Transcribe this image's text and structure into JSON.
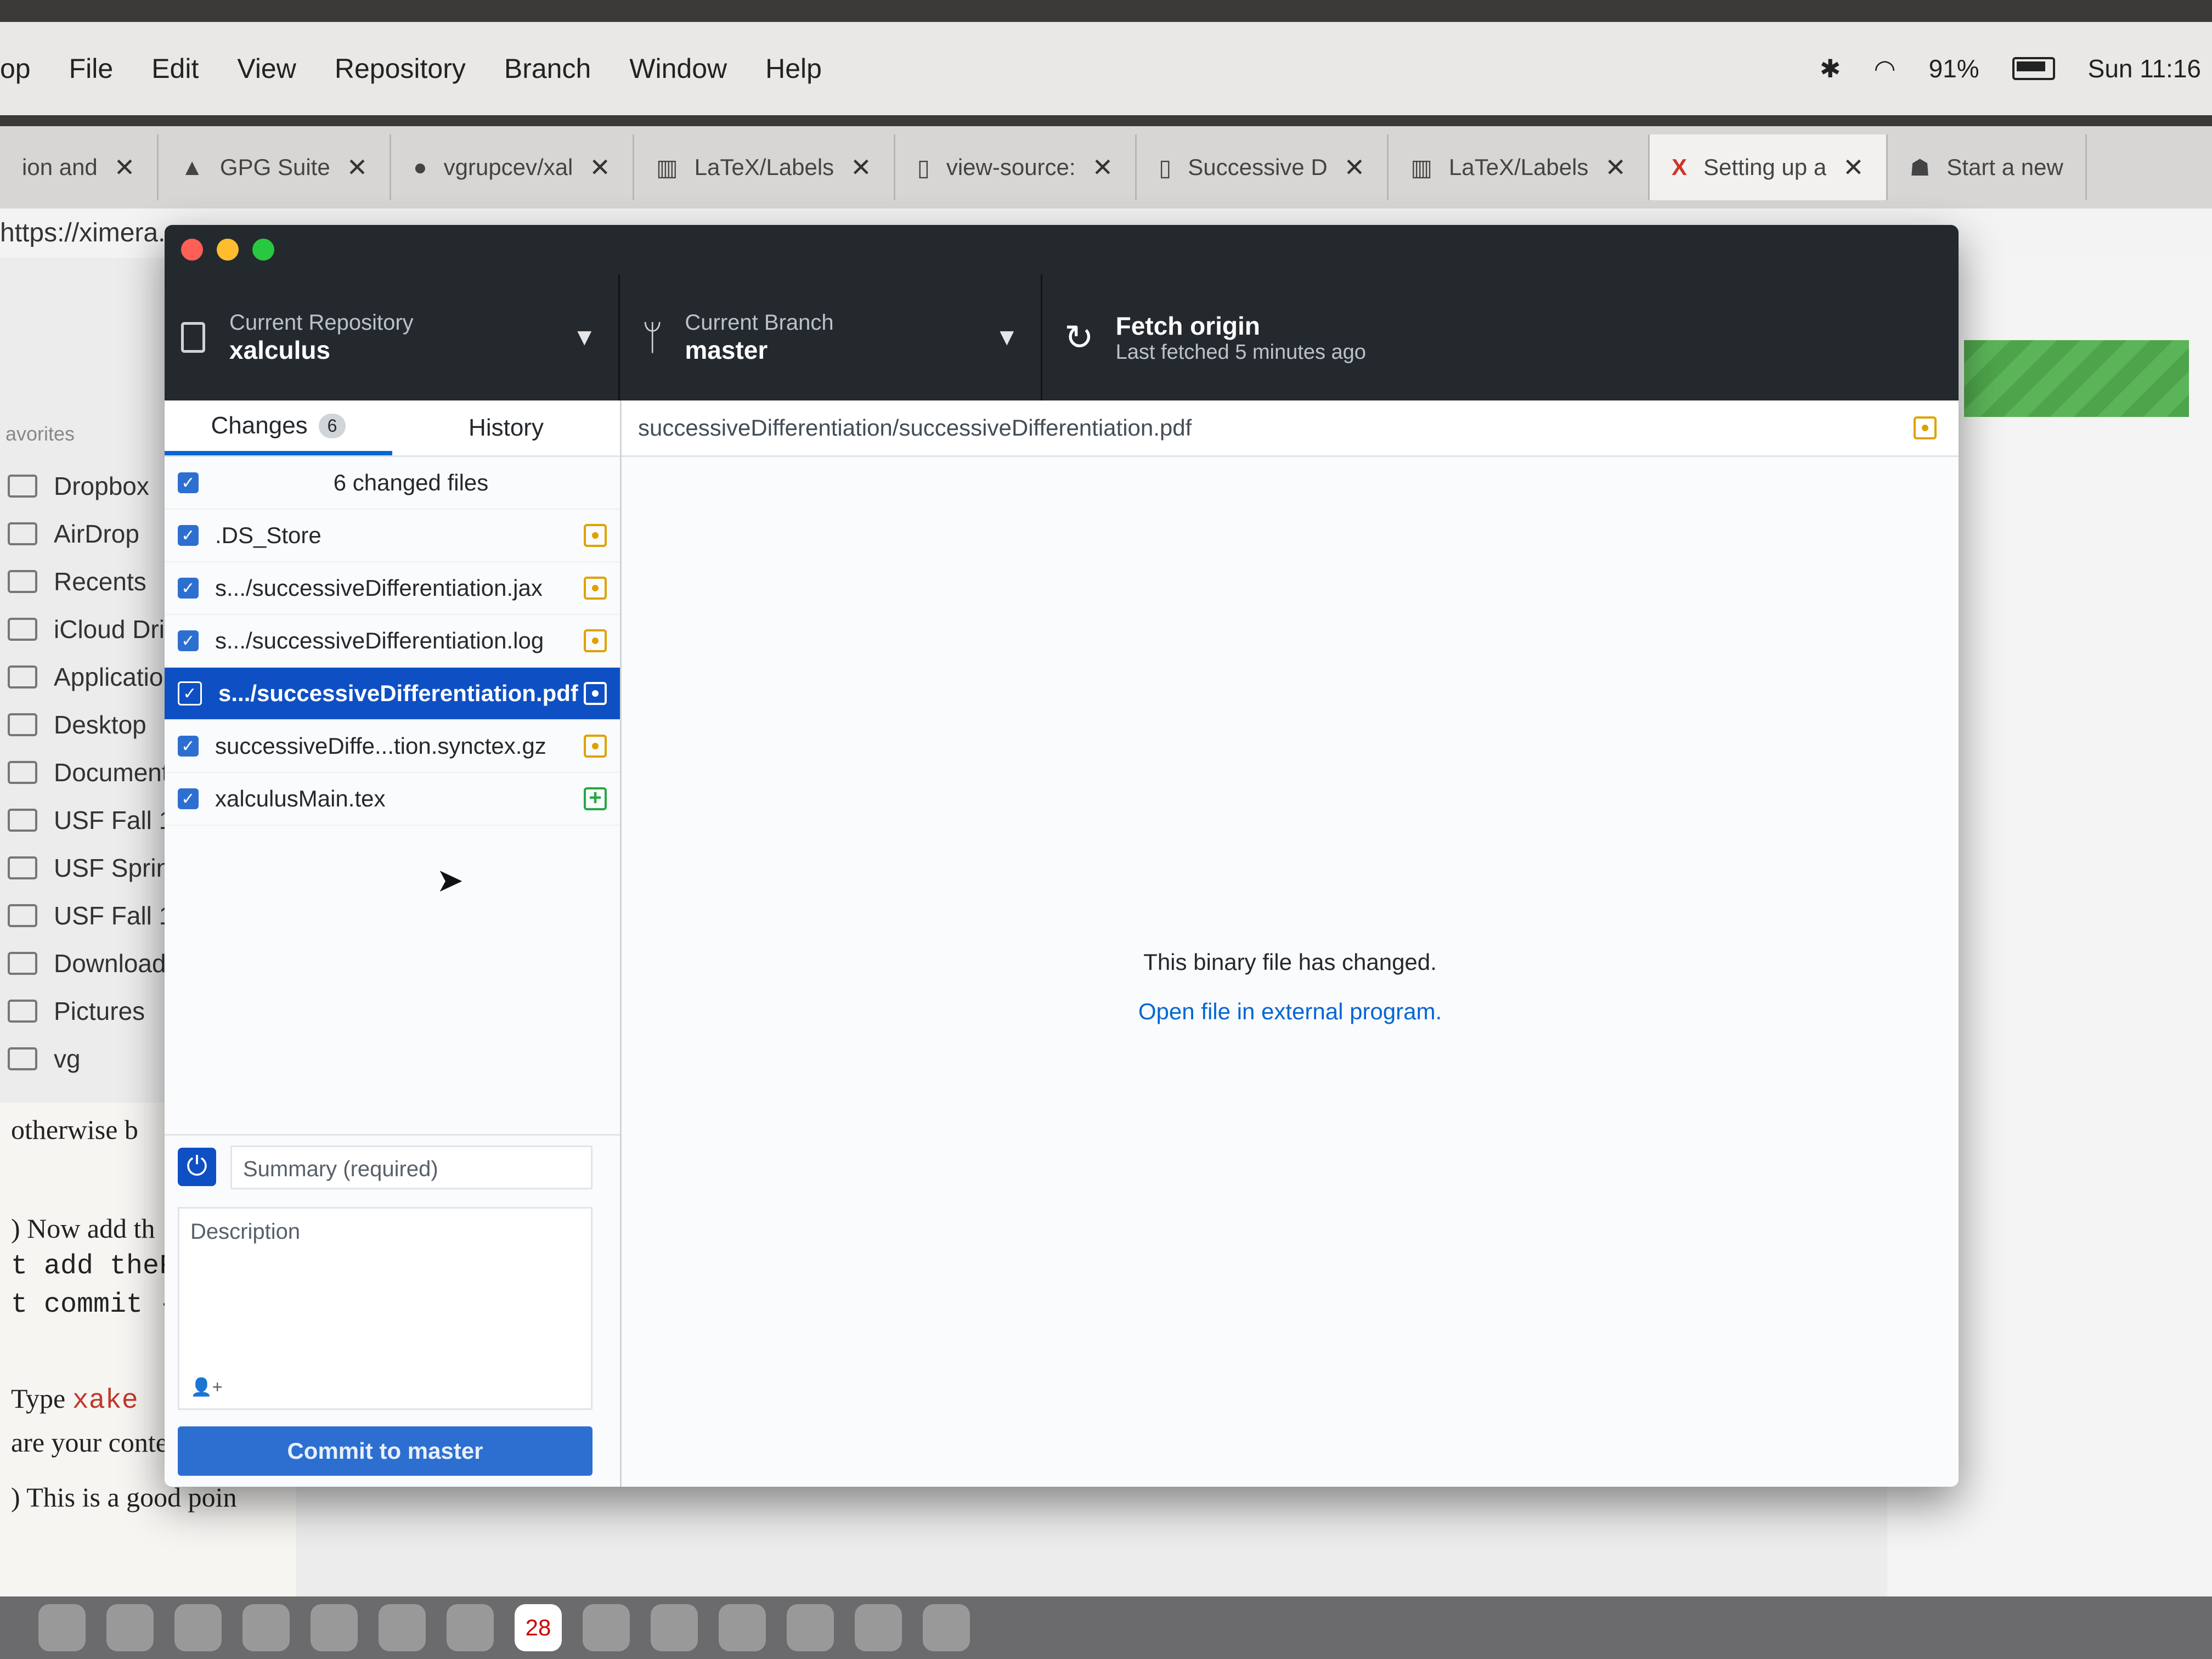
{
  "menubar": {
    "items": [
      "op",
      "File",
      "Edit",
      "View",
      "Repository",
      "Branch",
      "Window",
      "Help"
    ],
    "battery": "91%",
    "clock": "Sun 11:16"
  },
  "browser": {
    "tabs": [
      {
        "title": "ion and",
        "icon": "page-icon"
      },
      {
        "title": "GPG Suite",
        "icon": "lock-icon"
      },
      {
        "title": "vgrupcev/xal",
        "icon": "github-icon"
      },
      {
        "title": "LaTeX/Labels",
        "icon": "book-icon"
      },
      {
        "title": "view-source:",
        "icon": "page-icon"
      },
      {
        "title": "Successive D",
        "icon": "page-icon"
      },
      {
        "title": "LaTeX/Labels",
        "icon": "book-icon"
      },
      {
        "title": "Setting up a",
        "icon": "x-logo-icon"
      },
      {
        "title": "Start a new",
        "icon": "person-icon"
      }
    ],
    "url": "https://ximera.c"
  },
  "finder": {
    "heading": "avorites",
    "items": [
      "Dropbox",
      "AirDrop",
      "Recents",
      "iCloud Dri",
      "Applicatio",
      "Desktop",
      "Document",
      "USF Fall 1",
      "USF Sprin",
      "USF Fall 1",
      "Download",
      "Pictures",
      "vg"
    ]
  },
  "doc": {
    "line1": "otherwise b",
    "line2": ") Now add th",
    "line3": "t add theF",
    "line4": "t commit -",
    "line5a": "Type ",
    "line5b": "xake",
    "line6": "are your content wit",
    "line7": ") This is a good poin"
  },
  "dock": {
    "calendar_day": "28"
  },
  "toolbar": {
    "repo_label": "Current Repository",
    "repo_name": "xalculus",
    "branch_label": "Current Branch",
    "branch_name": "master",
    "fetch_label": "Fetch origin",
    "fetch_sub": "Last fetched 5 minutes ago"
  },
  "sidebar": {
    "tab_changes": "Changes",
    "changes_count": "6",
    "tab_history": "History",
    "changed_files_header": "6 changed files",
    "files": [
      {
        "name": ".DS_Store",
        "status": "modified"
      },
      {
        "name": "s.../successiveDifferentiation.jax",
        "status": "modified"
      },
      {
        "name": "s.../successiveDifferentiation.log",
        "status": "modified"
      },
      {
        "name": "s.../successiveDifferentiation.pdf",
        "status": "modified",
        "selected": true
      },
      {
        "name": "successiveDiffe...tion.synctex.gz",
        "status": "modified"
      },
      {
        "name": "xalculusMain.tex",
        "status": "added"
      }
    ]
  },
  "commit": {
    "summary_placeholder": "Summary (required)",
    "description_placeholder": "Description",
    "button_label": "Commit to master"
  },
  "diff": {
    "path": "successiveDifferentiation/successiveDifferentiation.pdf",
    "binary_message": "This binary file has changed.",
    "open_link": "Open file in external program."
  }
}
